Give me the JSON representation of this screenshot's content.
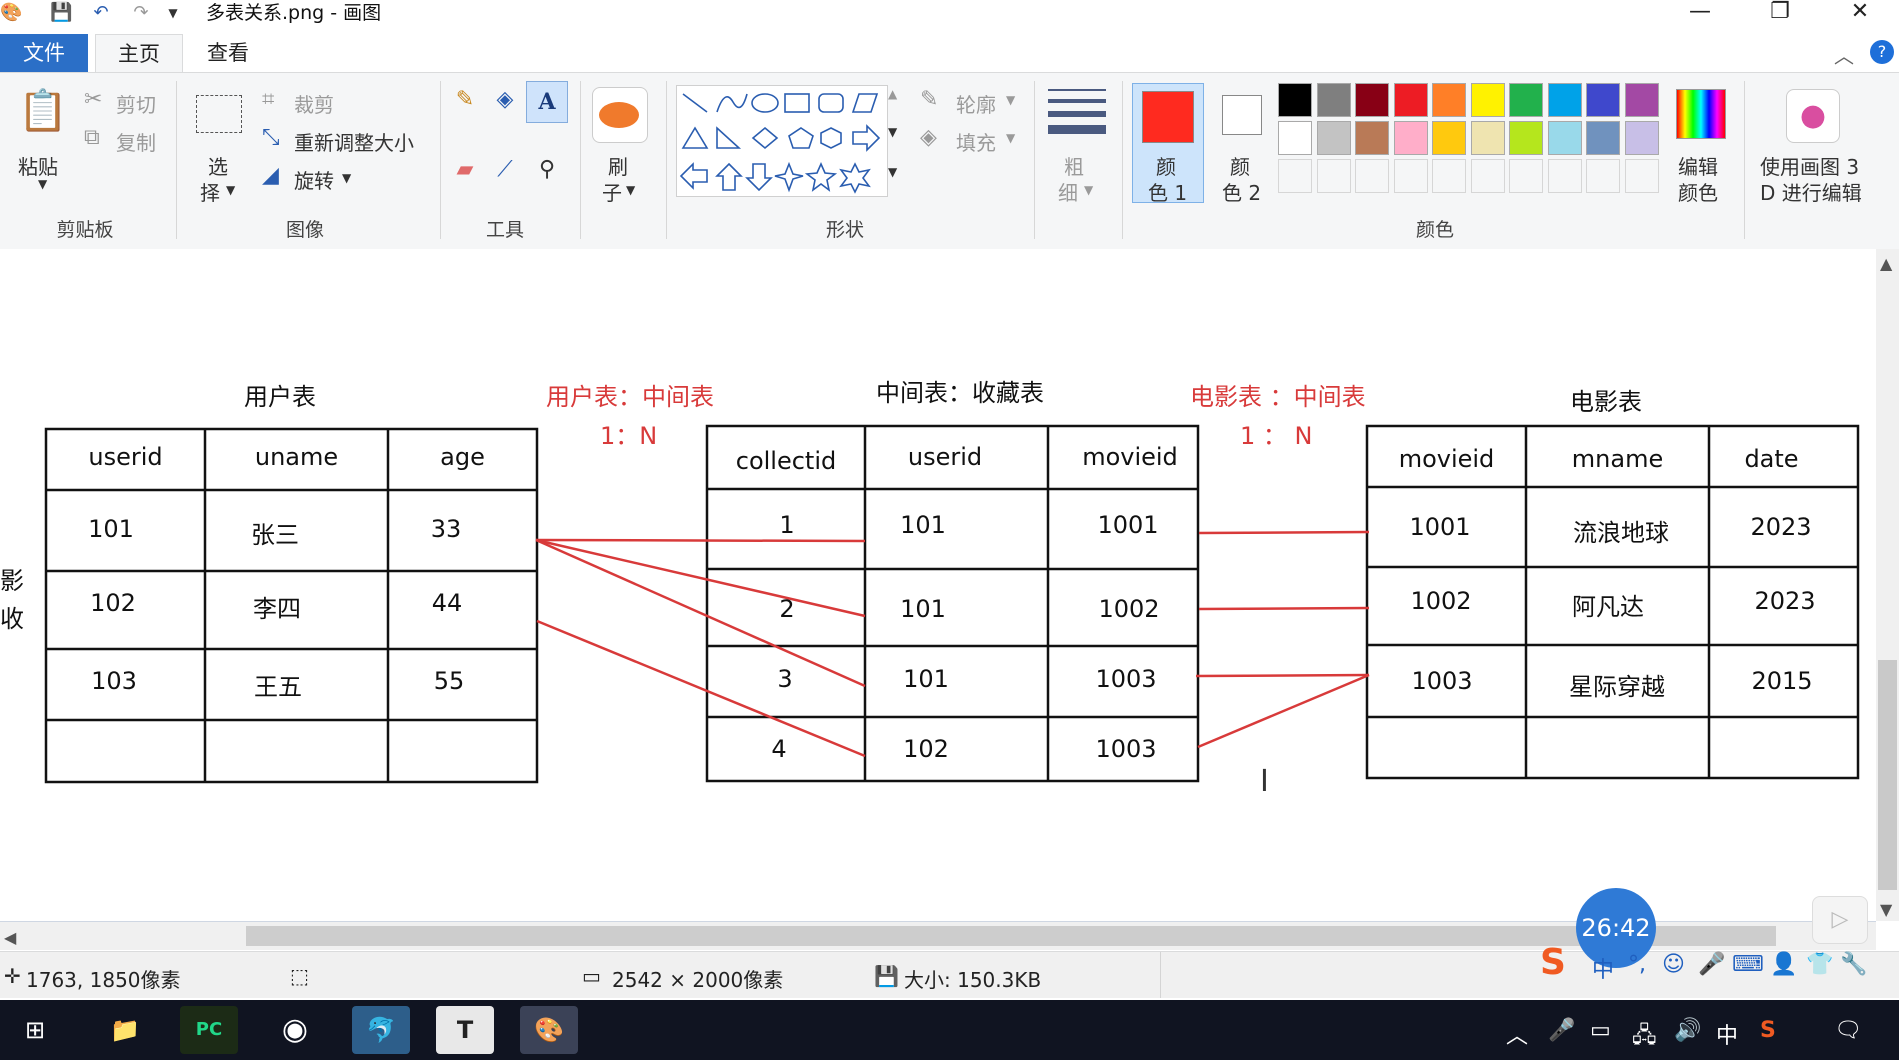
{
  "window": {
    "title": "多表关系.png - 画图",
    "minimize": "—",
    "restore": "❐",
    "close": "✕"
  },
  "tabs": {
    "file": "文件",
    "home": "主页",
    "view": "查看"
  },
  "ribbon": {
    "clipboard": {
      "label": "剪贴板",
      "paste": "粘贴",
      "cut": "剪切",
      "copy": "复制"
    },
    "image": {
      "label": "图像",
      "select_1": "选",
      "select_2": "择",
      "crop": "裁剪",
      "resize": "重新调整大小",
      "rotate": "旋转"
    },
    "tools": {
      "label": "工具"
    },
    "brushes": {
      "label_1": "刷",
      "label_2": "子"
    },
    "shapes": {
      "label": "形状",
      "outline": "轮廓",
      "fill": "填充"
    },
    "size": {
      "label_1": "粗",
      "label_2": "细"
    },
    "colors": {
      "label": "颜色",
      "color1_a": "颜",
      "color1_b": "色 1",
      "color2_a": "颜",
      "color2_b": "色 2",
      "edit_a": "编辑",
      "edit_b": "颜色",
      "paint3d_a": "使用画图 3",
      "paint3d_b": "D 进行编辑",
      "color1_value": "#ff2a1f",
      "color2_value": "#ffffff",
      "palette_row1": [
        "#000000",
        "#7f7f7f",
        "#880015",
        "#ed1c24",
        "#ff7f27",
        "#fff200",
        "#22b14c",
        "#00a2e8",
        "#3f48cc",
        "#a349a4"
      ],
      "palette_row2": [
        "#ffffff",
        "#c3c3c3",
        "#b97a57",
        "#ffaec9",
        "#ffc90e",
        "#efe4b0",
        "#b5e61d",
        "#99d9ea",
        "#7092be",
        "#c8bfe7"
      ]
    }
  },
  "drawing": {
    "users_title": "用户表",
    "users_headers": [
      "userid",
      "uname",
      "age"
    ],
    "users_rows": [
      [
        "101",
        "张三",
        "33"
      ],
      [
        "102",
        "李四",
        "44"
      ],
      [
        "103",
        "王五",
        "55"
      ]
    ],
    "rel1_a": "用户表：中间表",
    "rel1_b": "1：N",
    "collect_title": "中间表：收藏表",
    "collect_headers": [
      "collectid",
      "userid",
      "movieid"
    ],
    "collect_rows": [
      [
        "1",
        "101",
        "1001"
      ],
      [
        "2",
        "101",
        "1002"
      ],
      [
        "3",
        "101",
        "1003"
      ],
      [
        "4",
        "102",
        "1003"
      ]
    ],
    "rel2_a": "电影表 ：中间表",
    "rel2_b": "1 ： N",
    "movies_title": "电影表",
    "movies_headers": [
      "movieid",
      "mname",
      "date"
    ],
    "movies_rows": [
      [
        "1001",
        "流浪地球",
        "2023"
      ],
      [
        "1002",
        "阿凡达",
        "2023"
      ],
      [
        "1003",
        "星际穿越",
        "2015"
      ]
    ],
    "edge_text_a": "影",
    "edge_text_b": "收"
  },
  "status": {
    "cursor_pos": "1763, 1850像素",
    "image_size": "2542 × 2000像素",
    "file_size": "大小: 150.3KB"
  },
  "overlay": {
    "timer": "26:42",
    "ime_lang": "中"
  },
  "taskbar": {
    "tray_lang": "中"
  }
}
